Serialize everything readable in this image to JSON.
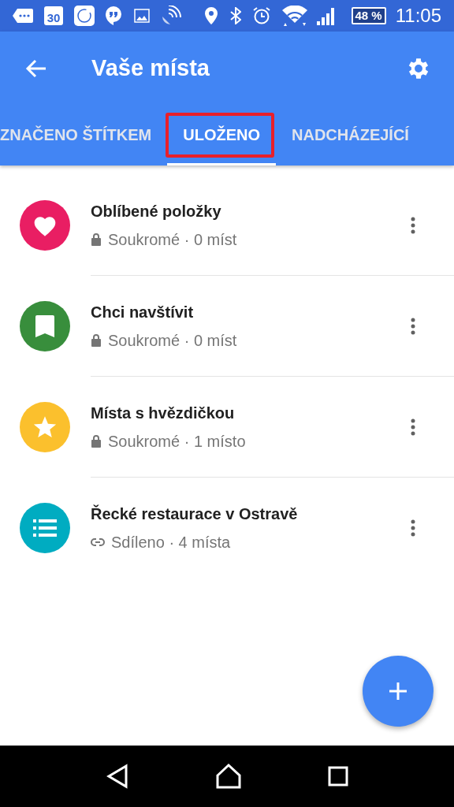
{
  "status_bar": {
    "calendar_day": "30",
    "battery": "48 %",
    "time": "11:05"
  },
  "app_bar": {
    "title": "Vaše místa"
  },
  "tabs": [
    {
      "label": "ZNAČENO ŠTÍTKEM",
      "selected": false,
      "highlighted": false
    },
    {
      "label": "ULOŽENO",
      "selected": true,
      "highlighted": true
    },
    {
      "label": "NADCHÁZEJÍCÍ",
      "selected": false,
      "highlighted": false
    }
  ],
  "lists": [
    {
      "title": "Oblíbené položky",
      "kind": "heart",
      "color": "#e91e63",
      "subtitle": {
        "kind": "private",
        "text": "Soukromé · 0 míst"
      }
    },
    {
      "title": "Chci navštívit",
      "kind": "bookmark",
      "color": "#388e3c",
      "subtitle": {
        "kind": "private",
        "text": "Soukromé · 0 míst"
      }
    },
    {
      "title": "Místa s hvězdičkou",
      "kind": "star",
      "color": "#fbc02d",
      "subtitle": {
        "kind": "private",
        "text": "Soukromé · 1 místo"
      }
    },
    {
      "title": "Řecké restaurace v Ostravě",
      "kind": "list",
      "color": "#00acc1",
      "subtitle": {
        "kind": "shared",
        "text": "Sdíleno · 4 místa"
      }
    }
  ]
}
